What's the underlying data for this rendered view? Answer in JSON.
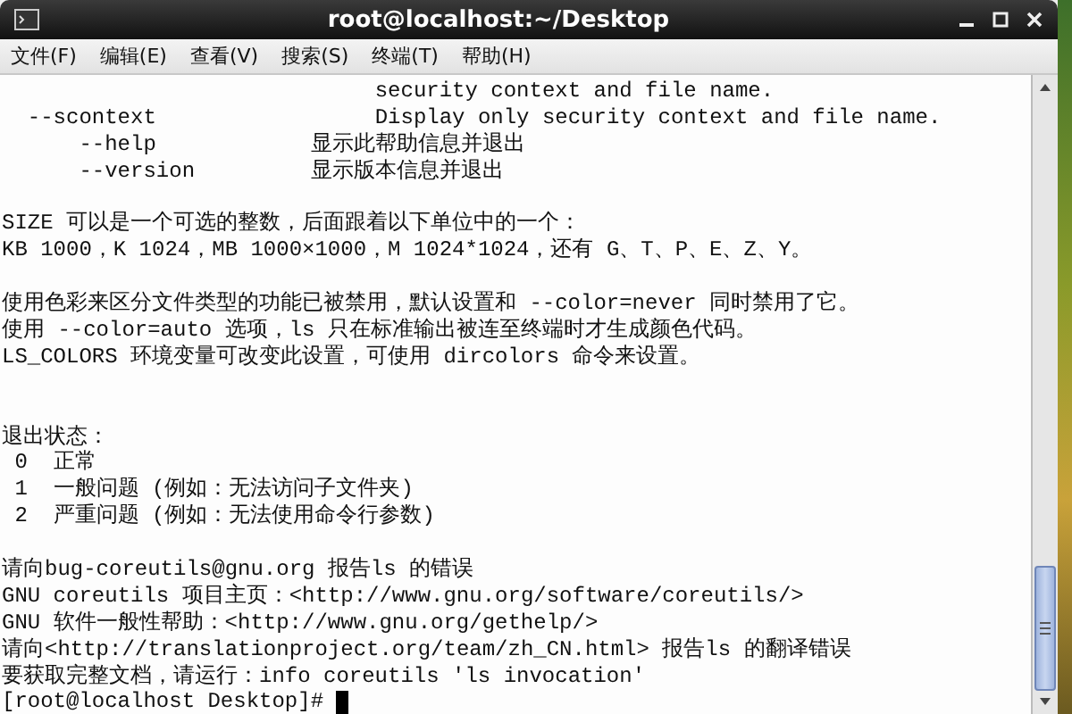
{
  "window": {
    "title": "root@localhost:~/Desktop"
  },
  "menu": [
    "文件(F)",
    "编辑(E)",
    "查看(V)",
    "搜索(S)",
    "终端(T)",
    "帮助(H)"
  ],
  "terminal": {
    "lines": [
      {
        "kind": "text",
        "text": "                             security context and file name."
      },
      {
        "kind": "text",
        "text": "  --scontext                 Display only security context and file name."
      },
      {
        "kind": "text",
        "text": "      --help            显示此帮助信息并退出"
      },
      {
        "kind": "text",
        "text": "      --version         显示版本信息并退出"
      },
      {
        "kind": "blank"
      },
      {
        "kind": "text",
        "text": "SIZE 可以是一个可选的整数，后面跟着以下单位中的一个："
      },
      {
        "kind": "text",
        "text": "KB 1000，K 1024，MB 1000×1000，M 1024*1024，还有 G、T、P、E、Z、Y。"
      },
      {
        "kind": "blank"
      },
      {
        "kind": "text",
        "text": "使用色彩来区分文件类型的功能已被禁用，默认设置和 --color=never 同时禁用了它。"
      },
      {
        "kind": "text",
        "text": "使用 --color=auto 选项，ls 只在标准输出被连至终端时才生成颜色代码。"
      },
      {
        "kind": "text",
        "text": "LS_COLORS 环境变量可改变此设置，可使用 dircolors 命令来设置。"
      },
      {
        "kind": "blank"
      },
      {
        "kind": "blank"
      },
      {
        "kind": "text",
        "text": "退出状态："
      },
      {
        "kind": "text",
        "text": " 0  正常"
      },
      {
        "kind": "text",
        "text": " 1  一般问题 (例如：无法访问子文件夹)"
      },
      {
        "kind": "text",
        "text": " 2  严重问题 (例如：无法使用命令行参数)"
      },
      {
        "kind": "blank"
      },
      {
        "kind": "text",
        "text": "请向bug-coreutils@gnu.org 报告ls 的错误"
      },
      {
        "kind": "text",
        "text": "GNU coreutils 项目主页：<http://www.gnu.org/software/coreutils/>"
      },
      {
        "kind": "text",
        "text": "GNU 软件一般性帮助：<http://www.gnu.org/gethelp/>"
      },
      {
        "kind": "text",
        "text": "请向<http://translationproject.org/team/zh_CN.html> 报告ls 的翻译错误"
      },
      {
        "kind": "text",
        "text": "要获取完整文档，请运行：info coreutils 'ls invocation'"
      },
      {
        "kind": "prompt",
        "text": "[root@localhost Desktop]# "
      }
    ]
  }
}
